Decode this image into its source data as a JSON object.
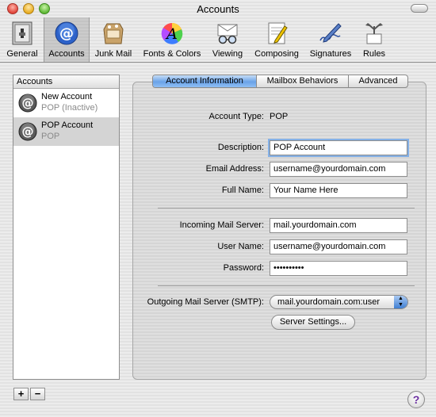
{
  "window": {
    "title": "Accounts"
  },
  "toolbar": {
    "items": [
      {
        "label": "General",
        "icon": "general-icon"
      },
      {
        "label": "Accounts",
        "icon": "accounts-icon"
      },
      {
        "label": "Junk Mail",
        "icon": "junk-mail-icon"
      },
      {
        "label": "Fonts & Colors",
        "icon": "fonts-colors-icon"
      },
      {
        "label": "Viewing",
        "icon": "viewing-icon"
      },
      {
        "label": "Composing",
        "icon": "composing-icon"
      },
      {
        "label": "Signatures",
        "icon": "signatures-icon"
      },
      {
        "label": "Rules",
        "icon": "rules-icon"
      }
    ],
    "selected": "Accounts"
  },
  "accounts": {
    "header": "Accounts",
    "items": [
      {
        "name": "New Account",
        "status": "POP (Inactive)"
      },
      {
        "name": "POP Account",
        "status": "POP"
      }
    ],
    "add_label": "+",
    "remove_label": "−"
  },
  "tabs": [
    {
      "label": "Account Information"
    },
    {
      "label": "Mailbox Behaviors"
    },
    {
      "label": "Advanced"
    }
  ],
  "form": {
    "account_type_label": "Account Type:",
    "account_type_value": "POP",
    "description_label": "Description:",
    "description_value": "POP Account",
    "email_label": "Email Address:",
    "email_value": "username@yourdomain.com",
    "fullname_label": "Full Name:",
    "fullname_value": "Your Name Here",
    "incoming_label": "Incoming Mail Server:",
    "incoming_value": "mail.yourdomain.com",
    "username_label": "User Name:",
    "username_value": "username@yourdomain.com",
    "password_label": "Password:",
    "password_value": "••••••••••",
    "smtp_label": "Outgoing Mail Server (SMTP):",
    "smtp_value": "mail.yourdomain.com:user",
    "server_settings_label": "Server Settings..."
  },
  "help_label": "?",
  "colors": {
    "tab_active": "#6aa2e8",
    "focus_ring": "#85b1e7",
    "selected_row": "#d4d4d4"
  }
}
